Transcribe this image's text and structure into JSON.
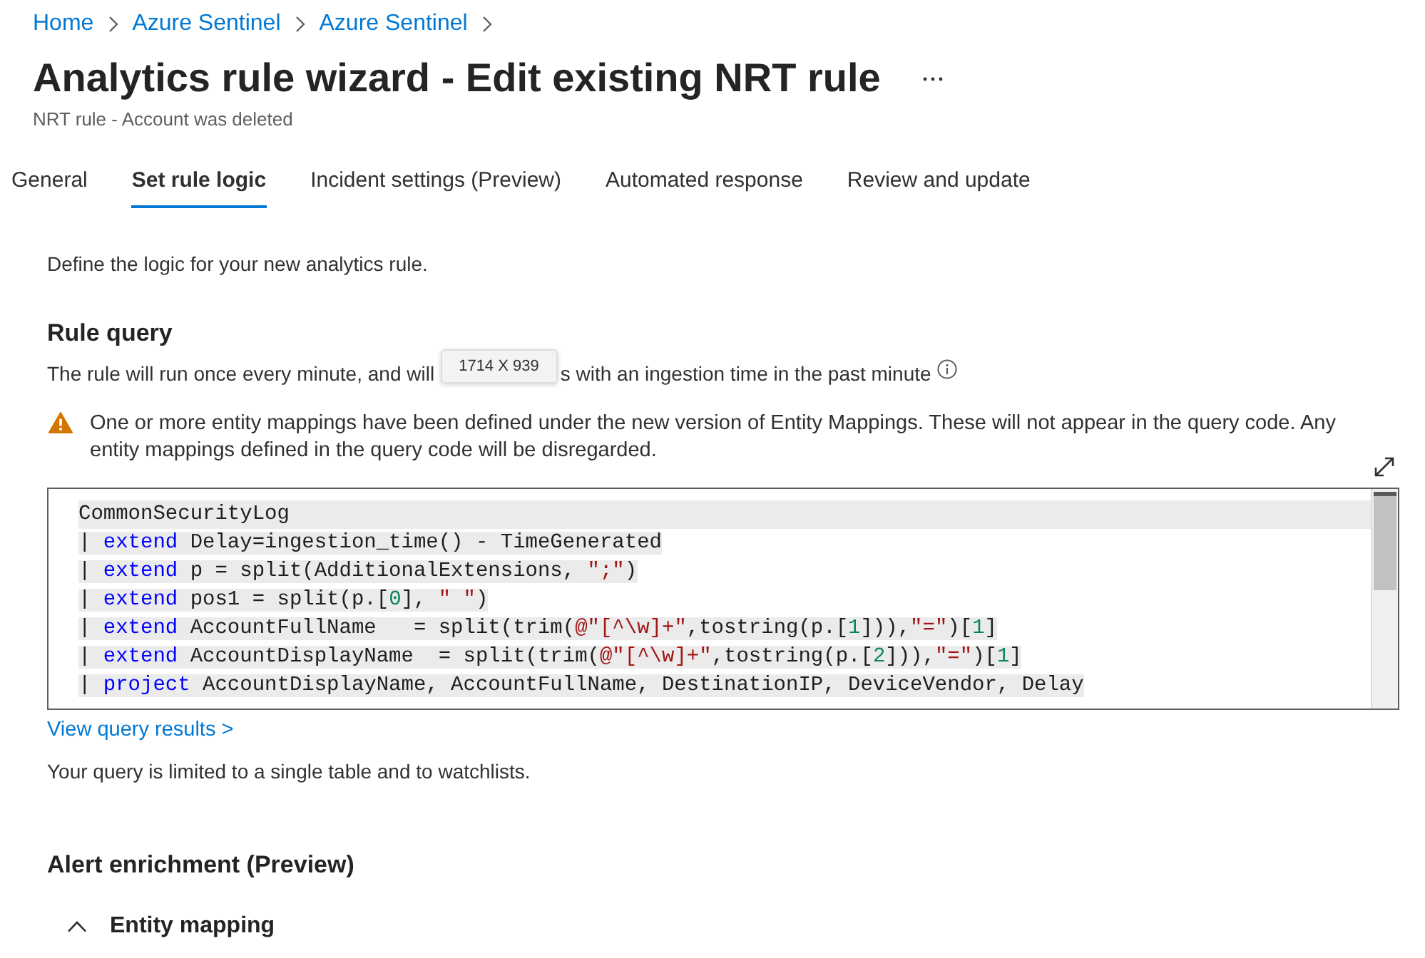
{
  "breadcrumb": [
    {
      "label": "Home"
    },
    {
      "label": "Azure Sentinel"
    },
    {
      "label": "Azure Sentinel"
    }
  ],
  "header": {
    "title": "Analytics rule wizard - Edit existing NRT rule",
    "subtitle": "NRT rule - Account was deleted"
  },
  "tabs": [
    {
      "label": "General",
      "selected": false
    },
    {
      "label": "Set rule logic",
      "selected": true
    },
    {
      "label": "Incident settings (Preview)",
      "selected": false
    },
    {
      "label": "Automated response",
      "selected": false
    },
    {
      "label": "Review and update",
      "selected": false
    }
  ],
  "intro": "Define the logic for your new analytics rule.",
  "rule_query": {
    "heading": "Rule query",
    "schedule_text_start": "The rule will run once every minute, and will",
    "size_tooltip": "1714 X 939",
    "schedule_text_end": "s with an ingestion time in the past minute",
    "warning": "One or more entity mappings have been defined under the new version of Entity Mappings. These will not appear in the query code. Any entity mappings defined in the query code will be disregarded.",
    "code_lines": [
      {
        "current": true,
        "tokens": [
          {
            "kind": "plain",
            "text": "CommonSecurityLog"
          }
        ]
      },
      {
        "current": false,
        "tokens": [
          {
            "kind": "plain",
            "text": "| "
          },
          {
            "kind": "keyword",
            "text": "extend"
          },
          {
            "kind": "plain",
            "text": " Delay=ingestion_time() - TimeGenerated"
          }
        ]
      },
      {
        "current": false,
        "tokens": [
          {
            "kind": "plain",
            "text": "| "
          },
          {
            "kind": "keyword",
            "text": "extend"
          },
          {
            "kind": "plain",
            "text": " p = split(AdditionalExtensions, "
          },
          {
            "kind": "string",
            "text": "\";\""
          },
          {
            "kind": "plain",
            "text": ")"
          }
        ]
      },
      {
        "current": false,
        "tokens": [
          {
            "kind": "plain",
            "text": "| "
          },
          {
            "kind": "keyword",
            "text": "extend"
          },
          {
            "kind": "plain",
            "text": " pos1 = split(p.["
          },
          {
            "kind": "number",
            "text": "0"
          },
          {
            "kind": "plain",
            "text": "], "
          },
          {
            "kind": "string",
            "text": "\" \""
          },
          {
            "kind": "plain",
            "text": ")"
          }
        ]
      },
      {
        "current": false,
        "tokens": [
          {
            "kind": "plain",
            "text": "| "
          },
          {
            "kind": "keyword",
            "text": "extend"
          },
          {
            "kind": "plain",
            "text": " AccountFullName   = split(trim("
          },
          {
            "kind": "string",
            "text": "@\"[^\\w]+\""
          },
          {
            "kind": "plain",
            "text": ",tostring(p.["
          },
          {
            "kind": "number",
            "text": "1"
          },
          {
            "kind": "plain",
            "text": "])),"
          },
          {
            "kind": "string",
            "text": "\"=\""
          },
          {
            "kind": "plain",
            "text": ")["
          },
          {
            "kind": "number",
            "text": "1"
          },
          {
            "kind": "plain",
            "text": "]"
          }
        ]
      },
      {
        "current": false,
        "tokens": [
          {
            "kind": "plain",
            "text": "| "
          },
          {
            "kind": "keyword",
            "text": "extend"
          },
          {
            "kind": "plain",
            "text": " AccountDisplayName  = split(trim("
          },
          {
            "kind": "string",
            "text": "@\"[^\\w]+\""
          },
          {
            "kind": "plain",
            "text": ",tostring(p.["
          },
          {
            "kind": "number",
            "text": "2"
          },
          {
            "kind": "plain",
            "text": "])),"
          },
          {
            "kind": "string",
            "text": "\"=\""
          },
          {
            "kind": "plain",
            "text": ")["
          },
          {
            "kind": "number",
            "text": "1"
          },
          {
            "kind": "plain",
            "text": "]"
          }
        ]
      },
      {
        "current": false,
        "tokens": [
          {
            "kind": "plain",
            "text": "| "
          },
          {
            "kind": "keyword",
            "text": "project"
          },
          {
            "kind": "plain",
            "text": " AccountDisplayName, AccountFullName, DestinationIP, DeviceVendor, Delay"
          }
        ]
      }
    ],
    "results_link": "View query results >",
    "note": "Your query is limited to a single table and to watchlists."
  },
  "alert_enrichment": {
    "heading": "Alert enrichment (Preview)",
    "entity_mapping": {
      "label": "Entity mapping",
      "expanded": true
    }
  }
}
